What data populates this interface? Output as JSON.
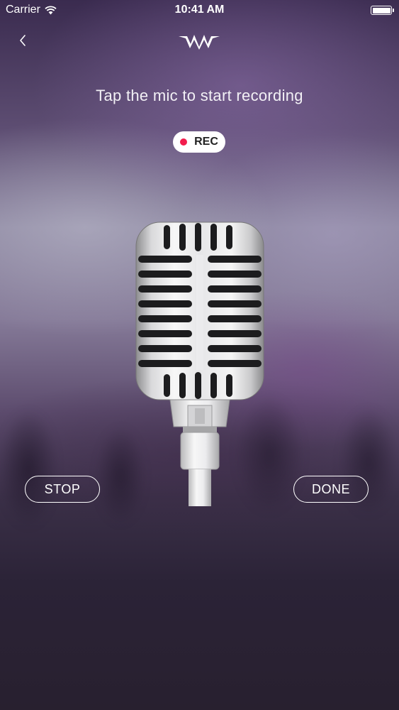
{
  "status_bar": {
    "carrier": "Carrier",
    "time": "10:41 AM"
  },
  "nav": {
    "back_icon": "chevron-left-icon",
    "logo_icon": "wave-logo-icon"
  },
  "prompt": "Tap the mic to start recording",
  "rec_badge": {
    "label": "REC",
    "dot_color": "#f21d4d"
  },
  "buttons": {
    "stop": "STOP",
    "done": "DONE"
  },
  "colors": {
    "accent_red": "#f21d4d",
    "background_dark": "#28202f"
  }
}
